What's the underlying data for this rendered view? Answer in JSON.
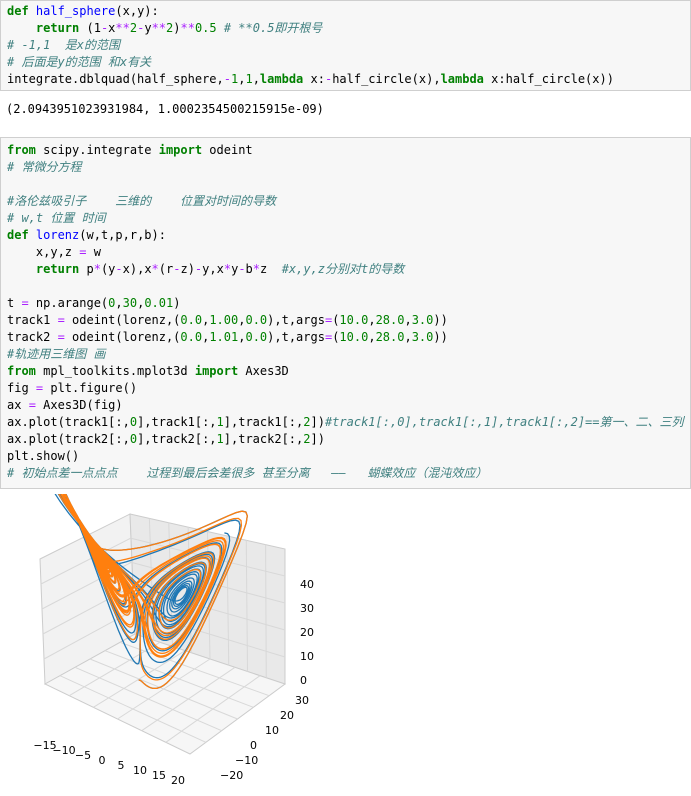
{
  "cell1": {
    "lines": [
      [
        [
          "kw",
          "def "
        ],
        [
          "fn",
          "half_sphere"
        ],
        [
          "tx",
          "(x,y):"
        ]
      ],
      [
        [
          "tx",
          "    "
        ],
        [
          "kw",
          "return "
        ],
        [
          "tx",
          "(1"
        ],
        [
          "op",
          "-"
        ],
        [
          "tx",
          "x"
        ],
        [
          "op",
          "**"
        ],
        [
          "nm",
          "2"
        ],
        [
          "op",
          "-"
        ],
        [
          "tx",
          "y"
        ],
        [
          "op",
          "**"
        ],
        [
          "nm",
          "2"
        ],
        [
          "tx",
          ")"
        ],
        [
          "op",
          "**"
        ],
        [
          "nm",
          "0.5"
        ],
        [
          "tx",
          " "
        ],
        [
          "cm",
          "# **0.5即开根号"
        ]
      ],
      [
        [
          "cm",
          "# -1,1  是x的范围"
        ]
      ],
      [
        [
          "cm",
          "# 后面是y的范围 和x有关"
        ]
      ],
      [
        [
          "tx",
          "integrate.dblquad(half_sphere,"
        ],
        [
          "op",
          "-"
        ],
        [
          "nm",
          "1"
        ],
        [
          "tx",
          ","
        ],
        [
          "nm",
          "1"
        ],
        [
          "tx",
          ","
        ],
        [
          "kw",
          "lambda "
        ],
        [
          "tx",
          "x:"
        ],
        [
          "op",
          "-"
        ],
        [
          "tx",
          "half_circle(x),"
        ],
        [
          "kw",
          "lambda "
        ],
        [
          "tx",
          "x:half_circle(x))"
        ]
      ]
    ]
  },
  "output1": "(2.0943951023931984, 1.0002354500215915e-09)",
  "cell2": {
    "lines": [
      [
        [
          "kw",
          "from "
        ],
        [
          "tx",
          "scipy.integrate "
        ],
        [
          "kw",
          "import "
        ],
        [
          "tx",
          "odeint"
        ]
      ],
      [
        [
          "cm",
          "# 常微分方程"
        ]
      ],
      [
        [
          "tx",
          ""
        ]
      ],
      [
        [
          "cm",
          "#洛伦兹吸引子    三维的    位置对时间的导数"
        ]
      ],
      [
        [
          "cm",
          "# w,t 位置 时间"
        ]
      ],
      [
        [
          "kw",
          "def "
        ],
        [
          "fn",
          "lorenz"
        ],
        [
          "tx",
          "(w,t,p,r,b):"
        ]
      ],
      [
        [
          "tx",
          "    x,y,z "
        ],
        [
          "op",
          "= "
        ],
        [
          "tx",
          "w"
        ]
      ],
      [
        [
          "tx",
          "    "
        ],
        [
          "kw",
          "return "
        ],
        [
          "tx",
          "p"
        ],
        [
          "op",
          "*"
        ],
        [
          "tx",
          "(y"
        ],
        [
          "op",
          "-"
        ],
        [
          "tx",
          "x),x"
        ],
        [
          "op",
          "*"
        ],
        [
          "tx",
          "(r"
        ],
        [
          "op",
          "-"
        ],
        [
          "tx",
          "z)"
        ],
        [
          "op",
          "-"
        ],
        [
          "tx",
          "y,x"
        ],
        [
          "op",
          "*"
        ],
        [
          "tx",
          "y"
        ],
        [
          "op",
          "-"
        ],
        [
          "tx",
          "b"
        ],
        [
          "op",
          "*"
        ],
        [
          "tx",
          "z  "
        ],
        [
          "cm",
          "#x,y,z分别对t的导数"
        ]
      ],
      [
        [
          "tx",
          ""
        ]
      ],
      [
        [
          "tx",
          "t "
        ],
        [
          "op",
          "= "
        ],
        [
          "tx",
          "np.arange("
        ],
        [
          "nm",
          "0"
        ],
        [
          "tx",
          ","
        ],
        [
          "nm",
          "30"
        ],
        [
          "tx",
          ","
        ],
        [
          "nm",
          "0.01"
        ],
        [
          "tx",
          ")"
        ]
      ],
      [
        [
          "tx",
          "track1 "
        ],
        [
          "op",
          "= "
        ],
        [
          "tx",
          "odeint(lorenz,("
        ],
        [
          "nm",
          "0.0"
        ],
        [
          "tx",
          ","
        ],
        [
          "nm",
          "1.00"
        ],
        [
          "tx",
          ","
        ],
        [
          "nm",
          "0.0"
        ],
        [
          "tx",
          "),t,args"
        ],
        [
          "op",
          "="
        ],
        [
          "tx",
          "("
        ],
        [
          "nm",
          "10.0"
        ],
        [
          "tx",
          ","
        ],
        [
          "nm",
          "28.0"
        ],
        [
          "tx",
          ","
        ],
        [
          "nm",
          "3.0"
        ],
        [
          "tx",
          "))"
        ]
      ],
      [
        [
          "tx",
          "track2 "
        ],
        [
          "op",
          "= "
        ],
        [
          "tx",
          "odeint(lorenz,("
        ],
        [
          "nm",
          "0.0"
        ],
        [
          "tx",
          ","
        ],
        [
          "nm",
          "1.01"
        ],
        [
          "tx",
          ","
        ],
        [
          "nm",
          "0.0"
        ],
        [
          "tx",
          "),t,args"
        ],
        [
          "op",
          "="
        ],
        [
          "tx",
          "("
        ],
        [
          "nm",
          "10.0"
        ],
        [
          "tx",
          ","
        ],
        [
          "nm",
          "28.0"
        ],
        [
          "tx",
          ","
        ],
        [
          "nm",
          "3.0"
        ],
        [
          "tx",
          "))"
        ]
      ],
      [
        [
          "cm",
          "#轨迹用三维图 画"
        ]
      ],
      [
        [
          "kw",
          "from "
        ],
        [
          "tx",
          "mpl_toolkits.mplot3d "
        ],
        [
          "kw",
          "import "
        ],
        [
          "tx",
          "Axes3D"
        ]
      ],
      [
        [
          "tx",
          "fig "
        ],
        [
          "op",
          "= "
        ],
        [
          "tx",
          "plt.figure()"
        ]
      ],
      [
        [
          "tx",
          "ax "
        ],
        [
          "op",
          "= "
        ],
        [
          "tx",
          "Axes3D(fig)"
        ]
      ],
      [
        [
          "tx",
          "ax.plot(track1[:,"
        ],
        [
          "nm",
          "0"
        ],
        [
          "tx",
          "],track1[:,"
        ],
        [
          "nm",
          "1"
        ],
        [
          "tx",
          "],track1[:,"
        ],
        [
          "nm",
          "2"
        ],
        [
          "tx",
          "])"
        ],
        [
          "cm",
          "#track1[:,0],track1[:,1],track1[:,2]==第一、二、三列"
        ]
      ],
      [
        [
          "tx",
          "ax.plot(track2[:,"
        ],
        [
          "nm",
          "0"
        ],
        [
          "tx",
          "],track2[:,"
        ],
        [
          "nm",
          "1"
        ],
        [
          "tx",
          "],track2[:,"
        ],
        [
          "nm",
          "2"
        ],
        [
          "tx",
          "])"
        ]
      ],
      [
        [
          "tx",
          "plt.show()"
        ]
      ],
      [
        [
          "cm",
          "# 初始点差一点点点    过程到最后会差很多 甚至分离   ——   蝴蝶效应（混沌效应）"
        ]
      ]
    ]
  },
  "plot": {
    "z_ticks": [
      "0",
      "10",
      "20",
      "30",
      "40"
    ],
    "y_ticks": [
      "30",
      "20",
      "10",
      "0",
      "−10",
      "−20"
    ],
    "x_ticks": [
      "−15",
      "−10",
      "−5",
      "0",
      "5",
      "10",
      "15",
      "20"
    ],
    "colors": {
      "track1": "#1f77b4",
      "track2": "#ff7f0e"
    }
  }
}
